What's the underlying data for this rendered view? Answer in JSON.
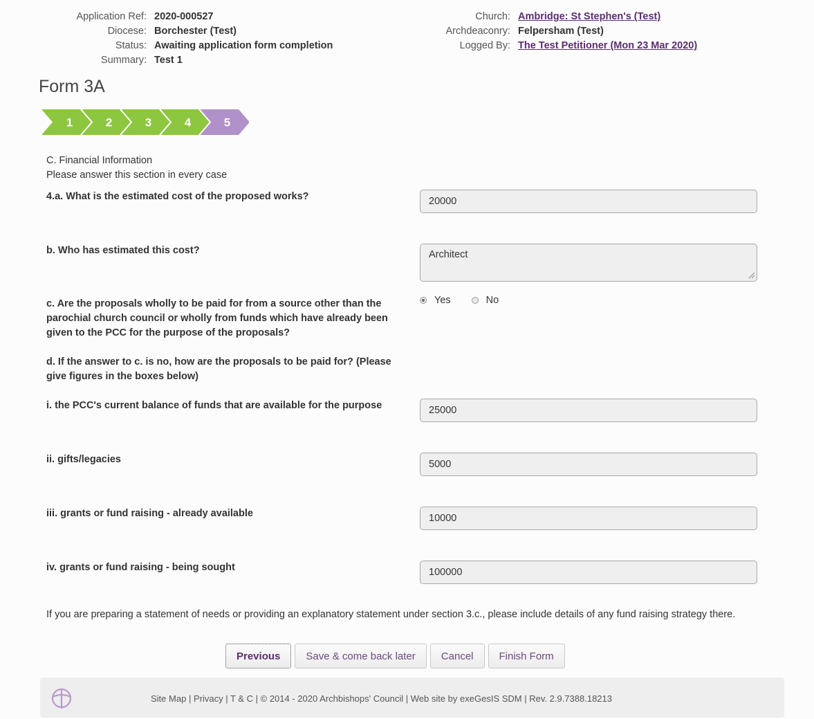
{
  "header": {
    "left": [
      {
        "label": "Application Ref:",
        "value": "2020-000527"
      },
      {
        "label": "Diocese:",
        "value": "Borchester (Test)"
      },
      {
        "label": "Status:",
        "value": "Awaiting application form completion"
      },
      {
        "label": "Summary:",
        "value": "Test 1"
      }
    ],
    "right": [
      {
        "label": "Church:",
        "value": "Ambridge: St Stephen's (Test)"
      },
      {
        "label": "Archdeaconry:",
        "value": "Felpersham (Test)"
      },
      {
        "label": "Logged By:",
        "value": "The Test Petitioner (Mon 23 Mar 2020)"
      }
    ]
  },
  "form_title": "Form 3A",
  "steps": {
    "items": [
      "1",
      "2",
      "3",
      "4",
      "5"
    ],
    "current": "5",
    "completed_color": "#8dc63f",
    "current_color": "#b191c9"
  },
  "section": {
    "title": "C. Financial Information",
    "subtitle": "Please answer this section in every case"
  },
  "questions": {
    "q4a": {
      "label": "4.a. What is the estimated cost of the proposed works?",
      "value": "20000"
    },
    "q4b": {
      "label": "b. Who has estimated this cost?",
      "value": "Architect"
    },
    "q4c": {
      "label": "c. Are the proposals wholly to be paid for from a source other than the parochial church council or wholly from funds which have already been given to the PCC for the purpose of the proposals?",
      "options": [
        "Yes",
        "No"
      ],
      "selected": "Yes"
    },
    "q4d": {
      "label": "d. If the answer to c. is no, how are the proposals to be paid for? (Please give figures in the boxes below)"
    },
    "qi": {
      "label": "i. the PCC's current balance of funds that are available for the purpose",
      "value": "25000"
    },
    "qii": {
      "label": "ii. gifts/legacies",
      "value": "5000"
    },
    "qiii": {
      "label": "iii. grants or fund raising - already available",
      "value": "10000"
    },
    "qiv": {
      "label": "iv. grants or fund raising - being sought",
      "value": "100000"
    }
  },
  "note": "If you are preparing a statement of needs or providing an explanatory statement under section 3.c., please include details of any fund raising strategy there.",
  "buttons": {
    "previous": "Previous",
    "save": "Save & come back later",
    "cancel": "Cancel",
    "finish": "Finish Form"
  },
  "footer": {
    "links": [
      "Site Map",
      "Privacy",
      "T & C"
    ],
    "copyright": "© 2014 - 2020 Archbishops' Council",
    "credit": "Web site by exeGesIS SDM",
    "revision": "Rev. 2.9.7388.18213",
    "separator": "|"
  }
}
